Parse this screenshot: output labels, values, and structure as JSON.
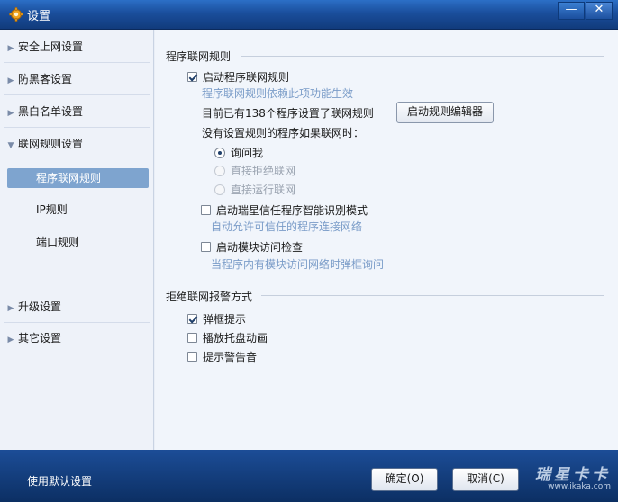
{
  "window": {
    "title": "设置",
    "minimize_label": "—",
    "close_label": "✕"
  },
  "sidebar": {
    "items": [
      {
        "label": "安全上网设置",
        "arrow": "▶"
      },
      {
        "label": "防黑客设置",
        "arrow": "▶"
      },
      {
        "label": "黑白名单设置",
        "arrow": "▶"
      },
      {
        "label": "联网规则设置",
        "arrow": "▼"
      }
    ],
    "subitems": [
      {
        "label": "程序联网规则",
        "active": true
      },
      {
        "label": "IP规则",
        "active": false
      },
      {
        "label": "端口规则",
        "active": false
      }
    ],
    "bottom_items": [
      {
        "label": "升级设置",
        "arrow": "▶"
      },
      {
        "label": "其它设置",
        "arrow": "▶"
      }
    ]
  },
  "main": {
    "section1": {
      "title": "程序联网规则",
      "enable_label": "启动程序联网规则",
      "enable_checked": true,
      "enable_hint": "程序联网规则依赖此项功能生效",
      "count_text": "目前已有138个程序设置了联网规则",
      "editor_button": "启动规则编辑器",
      "no_rule_text": "没有设置规则的程序如果联网时：",
      "radio_options": [
        {
          "label": "询问我",
          "checked": true,
          "disabled": false
        },
        {
          "label": "直接拒绝联网",
          "checked": false,
          "disabled": true
        },
        {
          "label": "直接运行联网",
          "checked": false,
          "disabled": true
        }
      ],
      "trusted_label": "启动瑞星信任程序智能识别模式",
      "trusted_checked": false,
      "trusted_hint": "自动允许可信任的程序连接网络",
      "module_label": "启动模块访问检查",
      "module_checked": false,
      "module_hint": "当程序内有模块访问网络时弹框询问"
    },
    "section2": {
      "title": "拒绝联网报警方式",
      "options": [
        {
          "label": "弹框提示",
          "checked": true
        },
        {
          "label": "播放托盘动画",
          "checked": false
        },
        {
          "label": "提示警告音",
          "checked": false
        }
      ]
    }
  },
  "footer": {
    "default_link": "使用默认设置",
    "ok_button": "确定(O)",
    "cancel_button": "取消(C)",
    "watermark_big": "瑞星卡卡",
    "watermark_small": "www.ikaka.com"
  }
}
